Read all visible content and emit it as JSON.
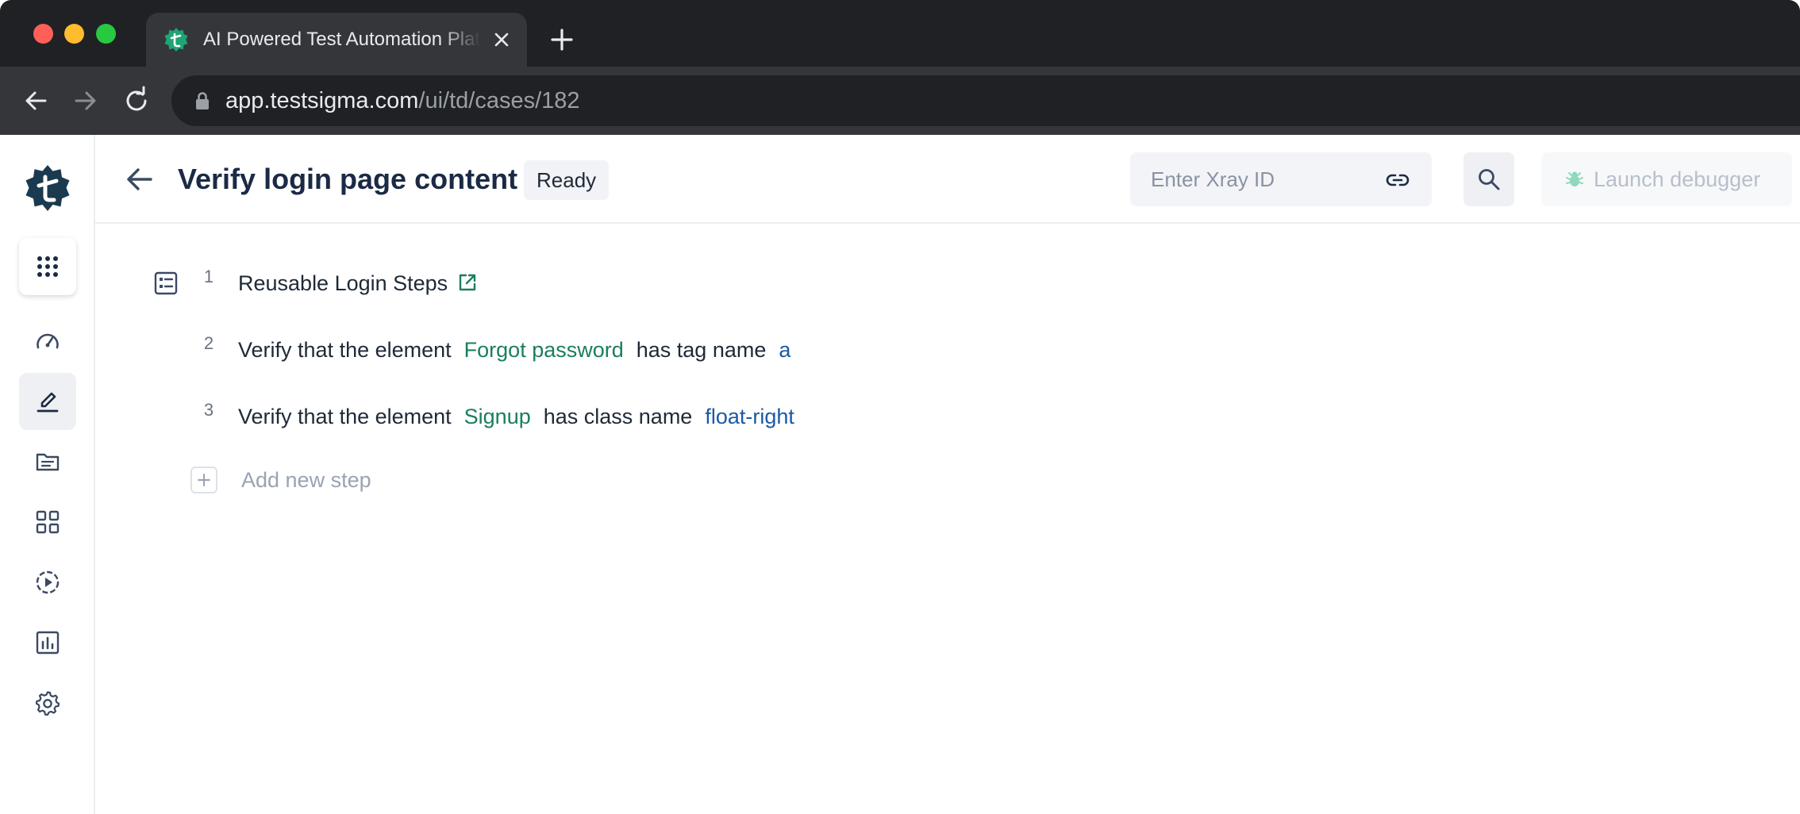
{
  "browser": {
    "tab_title": "AI Powered Test Automation Platform",
    "url_host": "app.testsigma.com",
    "url_path": "/ui/td/cases/182"
  },
  "sidebar": {
    "items": [
      {
        "name": "apps-grid-icon"
      },
      {
        "name": "dashboard-gauge-icon"
      },
      {
        "name": "test-development-pencil-icon",
        "active": true
      },
      {
        "name": "folder-icon"
      },
      {
        "name": "add-ons-grid-icon"
      },
      {
        "name": "run-play-icon"
      },
      {
        "name": "reports-chart-icon"
      },
      {
        "name": "settings-gear-icon"
      }
    ]
  },
  "header": {
    "title": "Verify login page content",
    "status": "Ready",
    "xray_placeholder": "Enter Xray ID",
    "debugger_label": "Launch debugger"
  },
  "steps": [
    {
      "number": "1",
      "text": "Reusable Login Steps"
    },
    {
      "number": "2",
      "prefix": "Verify that the element",
      "element": "Forgot password",
      "middle": "has tag name",
      "value": "a"
    },
    {
      "number": "3",
      "prefix": "Verify that the element",
      "element": "Signup",
      "middle": "has class name",
      "value": "float-right"
    }
  ],
  "add_step_label": "Add new step",
  "colors": {
    "brand_dark": "#1b3a4f",
    "brand_green": "#1fa574",
    "element_token": "#1a7f5a",
    "value_token": "#1a5aa6"
  }
}
